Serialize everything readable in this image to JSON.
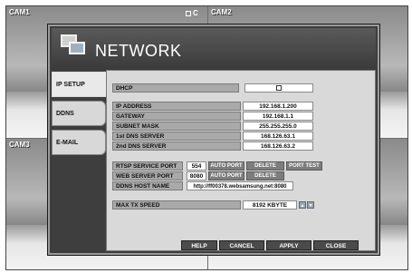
{
  "cameras": [
    {
      "label": "CAM1"
    },
    {
      "label": "CAM2"
    },
    {
      "label": "CAM3"
    },
    {
      "label": ""
    }
  ],
  "indicator": "C",
  "dialog": {
    "title": "NETWORK",
    "tabs": [
      "IP SETUP",
      "DDNS",
      "E-MAIL"
    ],
    "dhcp_label": "DHCP",
    "ip": {
      "address_label": "IP ADDRESS",
      "address": "192.168.1.200",
      "gateway_label": "GATEWAY",
      "gateway": "192.168.1.1",
      "subnet_label": "SUBNET MASK",
      "subnet": "255.255.255.0",
      "dns1_label": "1st DNS SERVER",
      "dns1": "168.126.63.1",
      "dns2_label": "2nd DNS SERVER",
      "dns2": "168.126.63.2"
    },
    "ports": {
      "rtsp_label": "RTSP SERVICE PORT",
      "rtsp": "554",
      "web_label": "WEB SERVER PORT",
      "web": "8080",
      "auto_port": "AUTO PORT",
      "delete_port": "DELETE PORT",
      "port_test": "PORT TEST",
      "ddns_label": "DDNS HOST NAME",
      "ddns": "http://ff00378.websamsung.net:8080"
    },
    "tx": {
      "label": "MAX TX SPEED",
      "value": "8192 KBYTE"
    },
    "footer": {
      "help": "HELP",
      "cancel": "CANCEL",
      "apply": "APPLY",
      "close": "CLOSE"
    }
  }
}
